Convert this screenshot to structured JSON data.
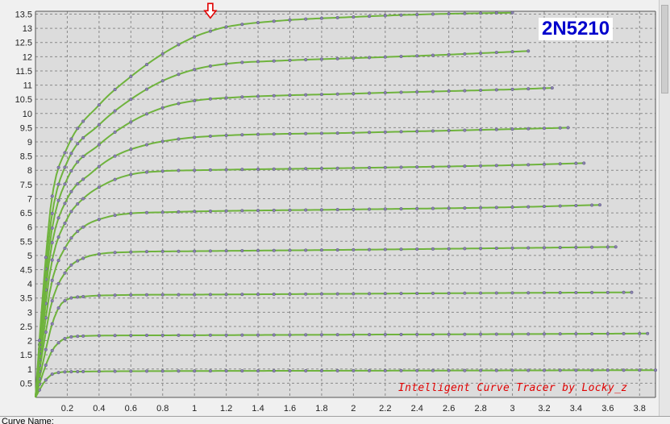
{
  "chart_data": {
    "type": "line",
    "title": "",
    "xlabel": "",
    "ylabel": "",
    "xlim": [
      0,
      3.9
    ],
    "ylim": [
      0,
      13.6
    ],
    "grid": true,
    "x_ticks": [
      0.2,
      0.4,
      0.6,
      0.8,
      1,
      1.2,
      1.4,
      1.6,
      1.8,
      2,
      2.2,
      2.4,
      2.6,
      2.8,
      3,
      3.2,
      3.4,
      3.6,
      3.8
    ],
    "y_ticks": [
      0.5,
      1,
      1.5,
      2,
      2.5,
      3,
      3.5,
      4,
      4.5,
      5,
      5.5,
      6,
      6.5,
      7,
      7.5,
      8,
      8.5,
      9,
      9.5,
      10,
      10.5,
      11,
      11.5,
      12,
      12.5,
      13,
      13.5
    ],
    "series": [
      {
        "points": [
          [
            0,
            0
          ],
          [
            0.05,
            0.5
          ],
          [
            0.1,
            0.8
          ],
          [
            0.15,
            0.88
          ],
          [
            0.2,
            0.9
          ],
          [
            0.3,
            0.91
          ],
          [
            0.5,
            0.92
          ],
          [
            1,
            0.93
          ],
          [
            2,
            0.94
          ],
          [
            3,
            0.95
          ],
          [
            3.9,
            0.96
          ]
        ]
      },
      {
        "points": [
          [
            0,
            0
          ],
          [
            0.05,
            0.9
          ],
          [
            0.1,
            1.6
          ],
          [
            0.15,
            1.95
          ],
          [
            0.2,
            2.1
          ],
          [
            0.3,
            2.16
          ],
          [
            0.5,
            2.18
          ],
          [
            1,
            2.19
          ],
          [
            2,
            2.21
          ],
          [
            3,
            2.23
          ],
          [
            3.85,
            2.25
          ]
        ]
      },
      {
        "points": [
          [
            0,
            0
          ],
          [
            0.05,
            1.3
          ],
          [
            0.1,
            2.5
          ],
          [
            0.15,
            3.2
          ],
          [
            0.2,
            3.45
          ],
          [
            0.3,
            3.55
          ],
          [
            0.5,
            3.6
          ],
          [
            1,
            3.62
          ],
          [
            2,
            3.65
          ],
          [
            3,
            3.68
          ],
          [
            3.75,
            3.7
          ]
        ]
      },
      {
        "points": [
          [
            0,
            0
          ],
          [
            0.05,
            1.8
          ],
          [
            0.1,
            3.3
          ],
          [
            0.2,
            4.5
          ],
          [
            0.3,
            4.9
          ],
          [
            0.4,
            5.05
          ],
          [
            0.6,
            5.12
          ],
          [
            1,
            5.15
          ],
          [
            2,
            5.2
          ],
          [
            3,
            5.26
          ],
          [
            3.65,
            5.3
          ]
        ]
      },
      {
        "points": [
          [
            0,
            0
          ],
          [
            0.05,
            2.2
          ],
          [
            0.1,
            4.0
          ],
          [
            0.2,
            5.4
          ],
          [
            0.3,
            6.0
          ],
          [
            0.45,
            6.35
          ],
          [
            0.6,
            6.48
          ],
          [
            0.8,
            6.52
          ],
          [
            1,
            6.55
          ],
          [
            2,
            6.62
          ],
          [
            3,
            6.7
          ],
          [
            3.55,
            6.78
          ]
        ]
      },
      {
        "points": [
          [
            0,
            0
          ],
          [
            0.05,
            2.6
          ],
          [
            0.1,
            4.7
          ],
          [
            0.2,
            6.3
          ],
          [
            0.3,
            7.0
          ],
          [
            0.45,
            7.55
          ],
          [
            0.6,
            7.85
          ],
          [
            0.8,
            7.97
          ],
          [
            1,
            8.0
          ],
          [
            2,
            8.08
          ],
          [
            3,
            8.18
          ],
          [
            3.45,
            8.25
          ]
        ]
      },
      {
        "points": [
          [
            0,
            0
          ],
          [
            0.05,
            3.0
          ],
          [
            0.1,
            5.3
          ],
          [
            0.2,
            7.0
          ],
          [
            0.35,
            7.9
          ],
          [
            0.5,
            8.5
          ],
          [
            0.7,
            8.9
          ],
          [
            0.9,
            9.1
          ],
          [
            1.1,
            9.2
          ],
          [
            2,
            9.32
          ],
          [
            3,
            9.45
          ],
          [
            3.35,
            9.5
          ]
        ]
      },
      {
        "points": [
          [
            0,
            0
          ],
          [
            0.05,
            3.3
          ],
          [
            0.1,
            5.8
          ],
          [
            0.2,
            7.7
          ],
          [
            0.4,
            8.9
          ],
          [
            0.6,
            9.7
          ],
          [
            0.8,
            10.2
          ],
          [
            1,
            10.45
          ],
          [
            1.2,
            10.55
          ],
          [
            2,
            10.7
          ],
          [
            3,
            10.85
          ],
          [
            3.25,
            10.9
          ]
        ]
      },
      {
        "points": [
          [
            0,
            0
          ],
          [
            0.05,
            3.6
          ],
          [
            0.1,
            6.3
          ],
          [
            0.2,
            8.3
          ],
          [
            0.4,
            9.6
          ],
          [
            0.6,
            10.5
          ],
          [
            0.8,
            11.15
          ],
          [
            1,
            11.55
          ],
          [
            1.2,
            11.75
          ],
          [
            1.5,
            11.85
          ],
          [
            2,
            11.95
          ],
          [
            2.5,
            12.05
          ],
          [
            3.1,
            12.2
          ]
        ]
      },
      {
        "points": [
          [
            0,
            0
          ],
          [
            0.05,
            3.9
          ],
          [
            0.1,
            6.9
          ],
          [
            0.2,
            8.8
          ],
          [
            0.4,
            10.3
          ],
          [
            0.6,
            11.3
          ],
          [
            0.8,
            12.1
          ],
          [
            1.0,
            12.7
          ],
          [
            1.1,
            12.9
          ],
          [
            1.2,
            13.05
          ],
          [
            1.5,
            13.25
          ],
          [
            2,
            13.4
          ],
          [
            2.5,
            13.5
          ],
          [
            3,
            13.55
          ]
        ]
      }
    ],
    "annotation": {
      "marker": "arrow-down",
      "x": 1.1,
      "y": 13.25
    },
    "colors": {
      "line": "#6fb33d",
      "point": "#8a82b0",
      "grid": "#8a8a8a",
      "plot_bg": "#dcdcdc",
      "arrow": "#e00000"
    }
  },
  "part_label": "2N5210",
  "credit": "Intelligent Curve Tracer by Locky_z",
  "bottom_panel": {
    "curve_name_label": "Curve Name:"
  }
}
